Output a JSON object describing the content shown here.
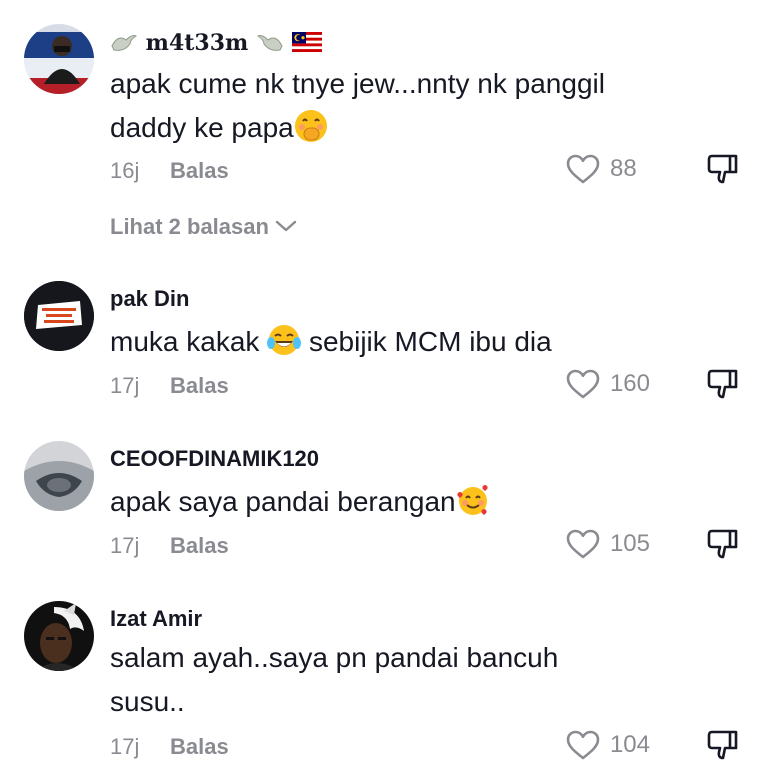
{
  "comments": [
    {
      "username": "m4t33m",
      "text_line1": "apak cume nk tnye jew...nnty nk panggil",
      "text_line2": "daddy ke papa",
      "time": "16j",
      "reply_label": "Balas",
      "likes": "88",
      "emoji_icon": "hand-over-mouth-emoji",
      "view_replies": "Lihat 2 balasan"
    },
    {
      "username": "pak Din",
      "text_part1": "muka kakak",
      "text_part2": "sebijik MCM ibu dia",
      "time": "17j",
      "reply_label": "Balas",
      "likes": "160",
      "emoji_icon": "tears-of-joy-emoji",
      "avatar_text": "LULUSKAN UNDI BERSAMA 18"
    },
    {
      "username": "CEOOFDINAMIK120",
      "text": "apak saya pandai berangan",
      "time": "17j",
      "reply_label": "Balas",
      "likes": "105",
      "emoji_icon": "smiling-face-with-hearts-emoji"
    },
    {
      "username": "Izat Amir",
      "text_line1": "salam ayah..saya pn pandai bancuh",
      "text_line2": "susu..",
      "time": "17j",
      "reply_label": "Balas",
      "likes": "104"
    }
  ],
  "colors": {
    "primary_text": "#161823",
    "secondary_text": "#8a8b91",
    "background": "#ffffff"
  }
}
